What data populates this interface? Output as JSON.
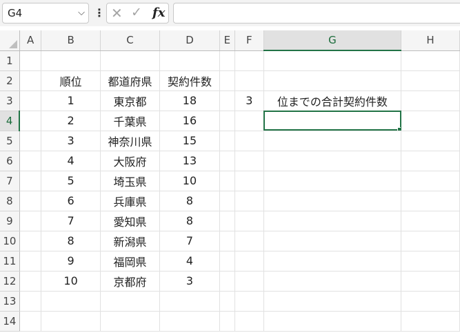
{
  "formula_bar": {
    "name_box": "G4",
    "name_box_arrow": "⌵",
    "more_icon": "⋮",
    "cancel_icon": "✕",
    "enter_icon": "✓",
    "fx_label": "fx",
    "formula": ""
  },
  "columns": [
    "A",
    "B",
    "C",
    "D",
    "E",
    "F",
    "G",
    "H"
  ],
  "active_cell": "G4",
  "rows": [
    {
      "row": "1",
      "cells": [
        "",
        "",
        "",
        "",
        "",
        "",
        "",
        ""
      ]
    },
    {
      "row": "2",
      "cells": [
        "",
        "順位",
        "都道府県",
        "契約件数",
        "",
        "",
        "",
        ""
      ]
    },
    {
      "row": "3",
      "cells": [
        "",
        "1",
        "東京都",
        "18",
        "",
        "3",
        "位までの合計契約件数",
        ""
      ]
    },
    {
      "row": "4",
      "cells": [
        "",
        "2",
        "千葉県",
        "16",
        "",
        "",
        "",
        ""
      ]
    },
    {
      "row": "5",
      "cells": [
        "",
        "3",
        "神奈川県",
        "15",
        "",
        "",
        "",
        ""
      ]
    },
    {
      "row": "6",
      "cells": [
        "",
        "4",
        "大阪府",
        "13",
        "",
        "",
        "",
        ""
      ]
    },
    {
      "row": "7",
      "cells": [
        "",
        "5",
        "埼玉県",
        "10",
        "",
        "",
        "",
        ""
      ]
    },
    {
      "row": "8",
      "cells": [
        "",
        "6",
        "兵庫県",
        "8",
        "",
        "",
        "",
        ""
      ]
    },
    {
      "row": "9",
      "cells": [
        "",
        "7",
        "愛知県",
        "8",
        "",
        "",
        "",
        ""
      ]
    },
    {
      "row": "10",
      "cells": [
        "",
        "8",
        "新潟県",
        "7",
        "",
        "",
        "",
        ""
      ]
    },
    {
      "row": "11",
      "cells": [
        "",
        "9",
        "福岡県",
        "4",
        "",
        "",
        "",
        ""
      ]
    },
    {
      "row": "12",
      "cells": [
        "",
        "10",
        "京都府",
        "3",
        "",
        "",
        "",
        ""
      ]
    },
    {
      "row": "13",
      "cells": [
        "",
        "",
        "",
        "",
        "",
        "",
        "",
        ""
      ]
    },
    {
      "row": "14",
      "cells": [
        "",
        "",
        "",
        "",
        "",
        "",
        "",
        ""
      ]
    }
  ]
}
